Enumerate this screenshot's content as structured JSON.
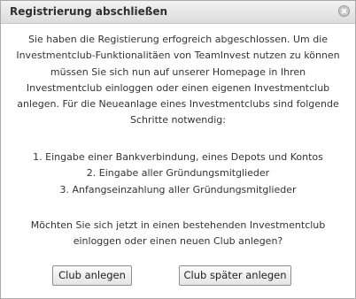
{
  "dialog": {
    "title": "Registrierung abschließen",
    "intro_lines": [
      "Sie haben die Registierung erfogreich abgeschlossen. Um die",
      "Investmentclub-Funktionalitäen von TeamInvest nutzen zu können",
      "müssen Sie sich nun auf unserer Homepage in Ihren",
      "Investmentclub einloggen oder einen eigenen Investmentclub",
      "anlegen. Für die Neueanlage eines Investmentclubs sind folgende",
      "Schritte notwendig:"
    ],
    "steps": [
      "1. Eingabe einer Bankverbindung, eines Depots und Kontos",
      "2. Eingabe aller Gründungsmitglieder",
      "3. Anfangseinzahlung aller Gründungsmitglieder"
    ],
    "question_lines": [
      "Möchten Sie sich jetzt in einen bestehenden Investmentclub",
      "einloggen oder einen neuen Club anlegen?"
    ],
    "buttons": {
      "create": "Club anlegen",
      "later": "Club später anlegen"
    },
    "close_icon": "close-icon"
  }
}
